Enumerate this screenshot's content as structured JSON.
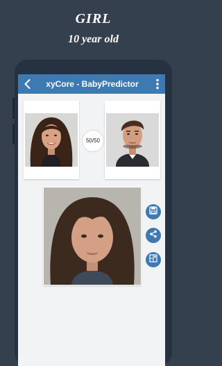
{
  "promo": {
    "title": "GIRL",
    "subtitle": "10 year old"
  },
  "app": {
    "title": "xyCore - BabyPredictor"
  },
  "ratio_badge": "50/50",
  "colors": {
    "appbar": "#3d7ab1",
    "background": "#35404f",
    "screen": "#f2f3f5"
  },
  "icons": {
    "back": "arrow-left-icon",
    "menu": "more-vert-icon",
    "save": "save-icon",
    "share": "share-icon",
    "gallery": "gallery-icon"
  }
}
